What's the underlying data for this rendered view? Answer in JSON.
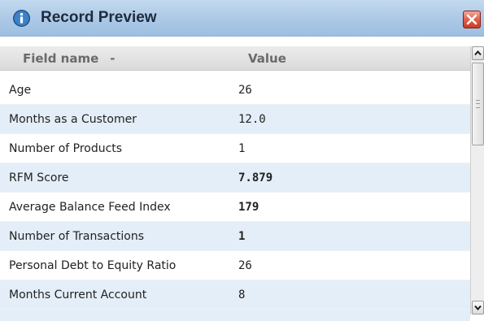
{
  "window": {
    "title": "Record Preview",
    "close_label": "Close"
  },
  "icons": {
    "title_icon": "info-icon",
    "close_icon": "close-x-icon",
    "scroll_up_icon": "chevron-up-icon",
    "scroll_down_icon": "chevron-down-icon"
  },
  "table": {
    "columns": {
      "field": "Field name",
      "sort_indicator": "-",
      "value": "Value"
    },
    "rows": [
      {
        "field": "Age",
        "value": "26",
        "bold": false
      },
      {
        "field": "Months as a Customer",
        "value": "12.0",
        "bold": false
      },
      {
        "field": "Number of Products",
        "value": "1",
        "bold": false
      },
      {
        "field": "RFM Score",
        "value": "7.879",
        "bold": true
      },
      {
        "field": "Average Balance Feed Index",
        "value": "179",
        "bold": true
      },
      {
        "field": "Number of Transactions",
        "value": "1",
        "bold": true
      },
      {
        "field": "Personal Debt to Equity Ratio",
        "value": "26",
        "bold": false
      },
      {
        "field": "Months Current Account",
        "value": "8",
        "bold": false
      }
    ]
  },
  "colors": {
    "titlebar": "#abc8e6",
    "row_alt": "#e3eef8",
    "close_button": "#e0604a"
  }
}
